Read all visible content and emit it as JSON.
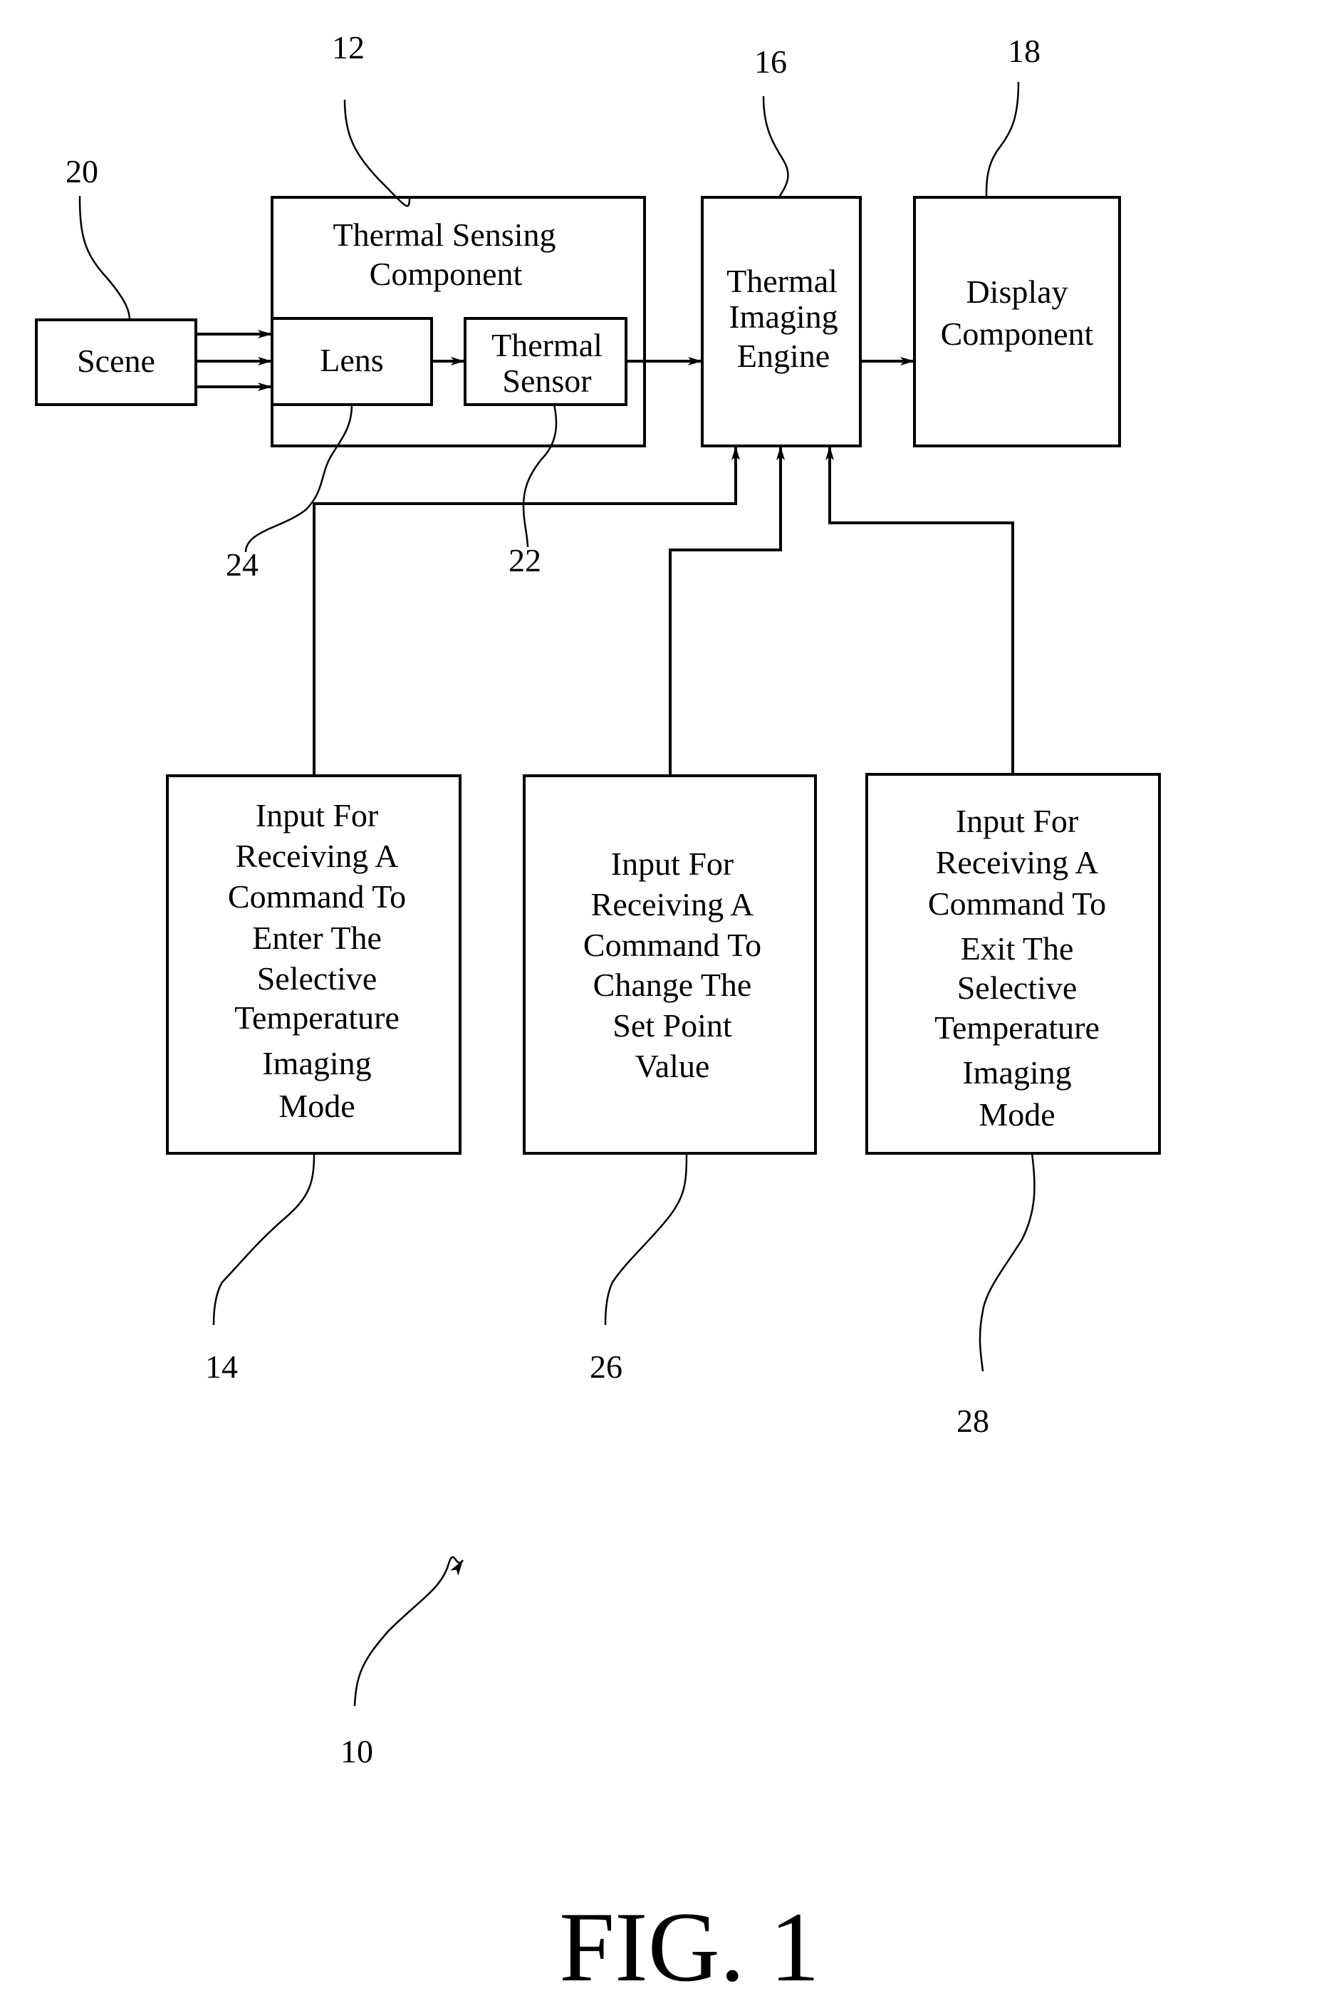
{
  "figure": {
    "caption": "FIG. 1",
    "system_ref": "10"
  },
  "blocks": {
    "scene": {
      "ref": "20",
      "lines": [
        "Scene"
      ]
    },
    "thermal_sensing_component": {
      "ref": "12",
      "lines": [
        "Thermal Sensing",
        "Component"
      ]
    },
    "lens": {
      "ref": "24",
      "lines": [
        "Lens"
      ]
    },
    "thermal_sensor": {
      "ref": "22",
      "lines": [
        "Thermal",
        "Sensor"
      ]
    },
    "thermal_imaging_engine": {
      "ref": "16",
      "lines": [
        "Thermal",
        "Imaging",
        "Engine"
      ]
    },
    "display_component": {
      "ref": "18",
      "lines": [
        "Display",
        "Component"
      ]
    },
    "input_enter_mode": {
      "ref": "14",
      "lines": [
        "Input For",
        "Receiving A",
        "Command To",
        "Enter The",
        "Selective",
        "Temperature",
        "Imaging",
        "Mode"
      ]
    },
    "input_change_set_point": {
      "ref": "26",
      "lines": [
        "Input For",
        "Receiving A",
        "Command To",
        "Change The",
        "Set Point",
        "Value"
      ]
    },
    "input_exit_mode": {
      "ref": "28",
      "lines": [
        "Input For",
        "Receiving A",
        "Command To",
        "Exit The",
        "Selective",
        "Temperature",
        "Imaging",
        "Mode"
      ]
    }
  },
  "connections": [
    {
      "from": "scene",
      "to": "lens",
      "count": 3
    },
    {
      "from": "lens",
      "to": "thermal_sensor"
    },
    {
      "from": "thermal_sensor",
      "to": "thermal_imaging_engine"
    },
    {
      "from": "thermal_imaging_engine",
      "to": "display_component"
    },
    {
      "from": "input_enter_mode",
      "to": "thermal_imaging_engine"
    },
    {
      "from": "input_change_set_point",
      "to": "thermal_imaging_engine"
    },
    {
      "from": "input_exit_mode",
      "to": "thermal_imaging_engine"
    }
  ]
}
